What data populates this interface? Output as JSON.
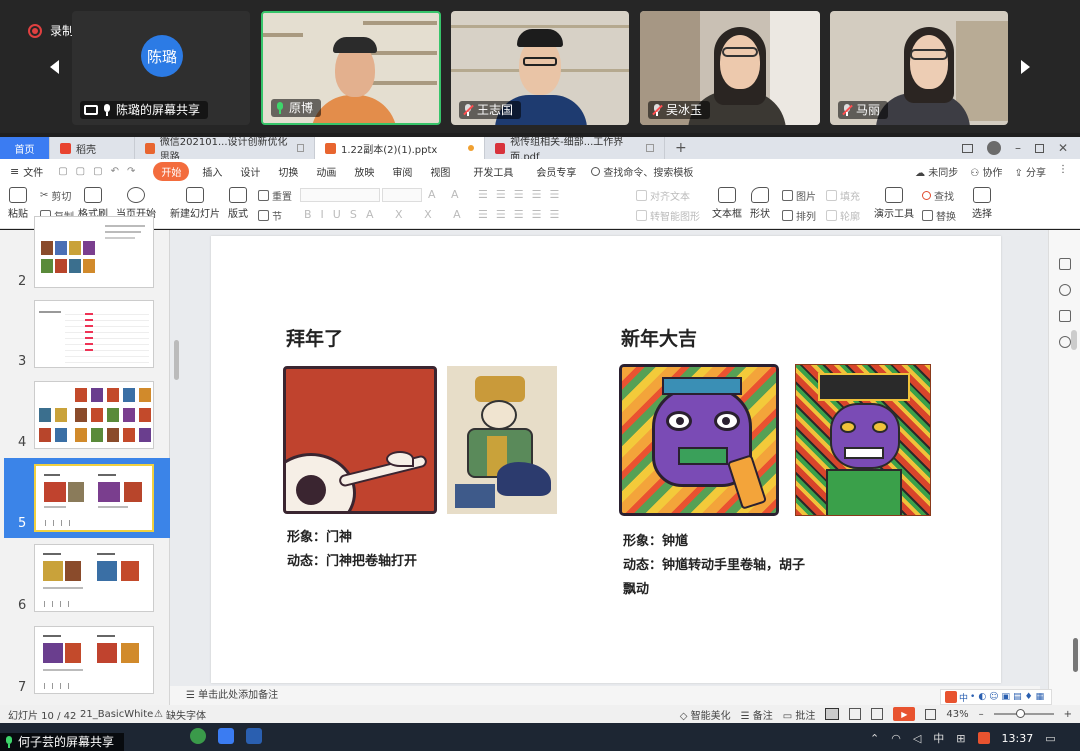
{
  "meeting": {
    "recording_label": "录制中",
    "presenter": {
      "avatar_text": "陈璐",
      "label": "陈璐的屏幕共享"
    },
    "participants": [
      {
        "name": "原博",
        "mic": "active"
      },
      {
        "name": "王志国",
        "mic": "muted"
      },
      {
        "name": "吴冰玉",
        "mic": "muted"
      },
      {
        "name": "马丽",
        "mic": "muted"
      }
    ]
  },
  "tabs": [
    {
      "label": "首页"
    },
    {
      "label": "稻壳"
    },
    {
      "label": "微信202101...设计创新优化思路"
    },
    {
      "label": "1.22副本(2)(1).pptx"
    },
    {
      "label": "视传组相关-细部...工作界面.pdf"
    }
  ],
  "menus": [
    "文件",
    "开始",
    "插入",
    "设计",
    "切换",
    "动画",
    "放映",
    "审阅",
    "视图",
    "开发工具",
    "会员专享"
  ],
  "search_placeholder": "查找命令、搜索模板",
  "menu_right": [
    "未同步",
    "协作",
    "分享"
  ],
  "toolbar": {
    "paste": "粘贴",
    "cut": "剪切",
    "copy": "复制",
    "format_painter": "格式刷",
    "from_current": "当页开始",
    "new_slide": "新建幻灯片",
    "layout": "版式",
    "reset": "重置",
    "section": "节",
    "align_text": "对齐文本",
    "smart_shape": "转智能图形",
    "textbox": "文本框",
    "shape": "形状",
    "picture": "图片",
    "fill": "填充",
    "arrange": "排列",
    "outline": "轮廓",
    "present_tools": "演示工具",
    "find": "查找",
    "replace": "替换",
    "select": "选择"
  },
  "thumbnails": [
    {
      "number": "2"
    },
    {
      "number": "3"
    },
    {
      "number": "4"
    },
    {
      "number": "5",
      "selected": true
    },
    {
      "number": "6"
    },
    {
      "number": "7"
    }
  ],
  "slide": {
    "left": {
      "title": "拜年了",
      "line1": "形象：门神",
      "line2": "动态：门神把卷轴打开"
    },
    "right": {
      "title": "新年大吉",
      "line1": "形象：钟馗",
      "line2": "动态：钟馗转动手里卷轴，胡子",
      "line3": "飘动"
    }
  },
  "notes_placeholder": "单击此处添加备注",
  "status": {
    "slide_count": "幻灯片 10 / 42",
    "theme": "21_BasicWhite",
    "missing_font": "缺失字体",
    "beautify": "智能美化",
    "notes": "备注",
    "comments": "批注",
    "zoom": "43%"
  },
  "taskbar": {
    "share_label": "何子芸的屏幕共享",
    "ime": "中",
    "time": "13:37"
  },
  "colors": {
    "accent": "#3b7cf2",
    "start_tab": "#f36c3d",
    "selection": "#3b84e8"
  }
}
